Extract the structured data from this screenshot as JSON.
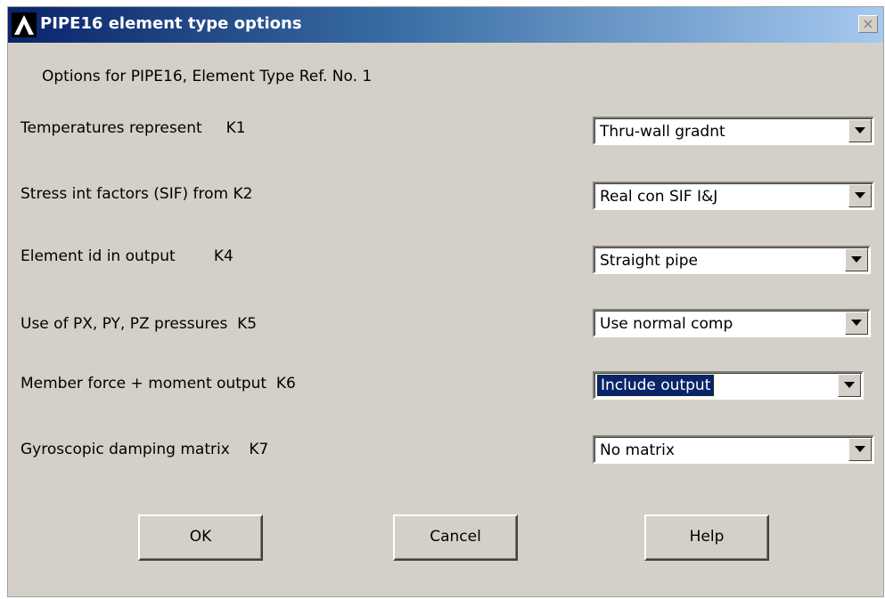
{
  "window": {
    "title": "PIPE16 element type options",
    "close_glyph": "×",
    "logo_icon": "ansys-logo-icon"
  },
  "subtitle": "Options for PIPE16, Element Type Ref. No. 1",
  "options": [
    {
      "label": "Temperatures represent     K1",
      "value": "Thru-wall gradnt"
    },
    {
      "label": "Stress int factors (SIF) from K2",
      "value": "Real con SIF I&J"
    },
    {
      "label": "Element id in output        K4",
      "value": "Straight pipe"
    },
    {
      "label": "Use of PX, PY, PZ pressures  K5",
      "value": "Use normal comp"
    },
    {
      "label": "Member force + moment output  K6",
      "value": "Include output"
    },
    {
      "label": "Gyroscopic damping matrix    K7",
      "value": "No matrix"
    }
  ],
  "buttons": {
    "ok": "OK",
    "cancel": "Cancel",
    "help": "Help"
  },
  "colors": {
    "titlebar_start": "#0a246a",
    "titlebar_end": "#a6caf0",
    "dialog_bg": "#d4d0c8",
    "selection": "#0a246a"
  }
}
